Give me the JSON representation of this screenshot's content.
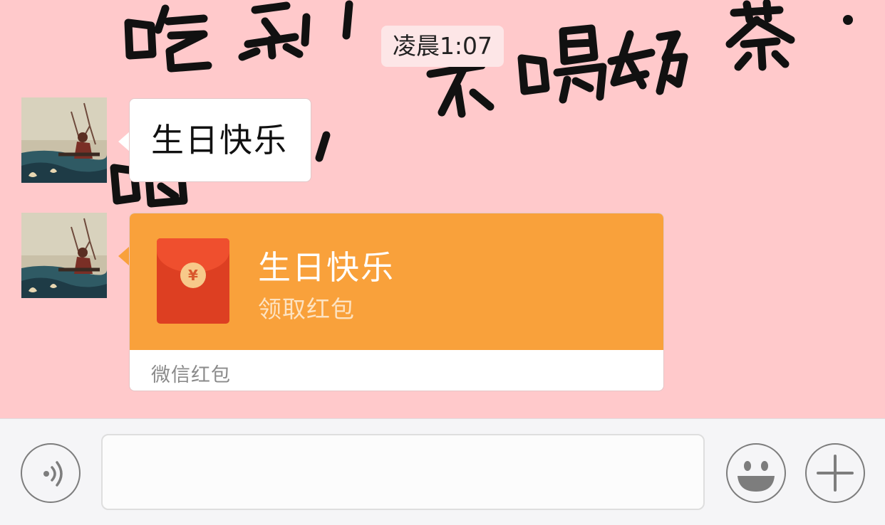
{
  "chat": {
    "timestamp": "凌晨1:07",
    "messages": [
      {
        "type": "text",
        "sender_avatar": "avatar-image",
        "text": "生日快乐"
      },
      {
        "type": "red_packet",
        "sender_avatar": "avatar-image",
        "title": "生日快乐",
        "subtitle": "领取红包",
        "footer": "微信红包",
        "coin_symbol": "¥"
      }
    ],
    "wallpaper_text": "吃不吃，喝不喝奶茶"
  },
  "input_bar": {
    "voice_icon": "voice-icon",
    "input_value": "",
    "emoji_icon": "emoji-icon",
    "more_icon": "plus-icon"
  },
  "colors": {
    "chat_background": "#ffc9cb",
    "red_packet_orange": "#f9a13b",
    "red_envelope": "#dd3f22"
  }
}
